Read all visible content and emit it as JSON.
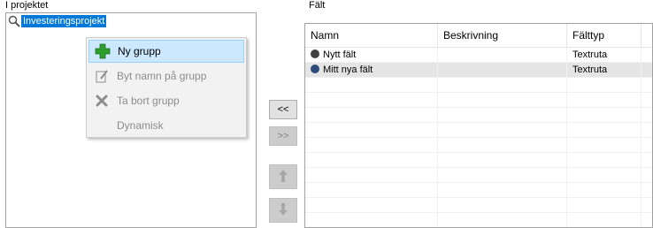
{
  "left_panel": {
    "title": "I projektet",
    "tree_root_label": "Investeringsprojekt"
  },
  "context_menu": {
    "items": [
      {
        "label": "Ny grupp",
        "icon": "plus-icon",
        "enabled": true,
        "highlighted": true
      },
      {
        "label": "Byt namn på grupp",
        "icon": "rename-icon",
        "enabled": false
      },
      {
        "label": "Ta bort grupp",
        "icon": "delete-icon",
        "enabled": false
      },
      {
        "label": "Dynamisk",
        "icon": "",
        "enabled": false
      }
    ]
  },
  "middle_buttons": {
    "move_left": "<<",
    "move_right": ">>",
    "move_up_icon": "arrow-up-icon",
    "move_down_icon": "arrow-down-icon"
  },
  "right_panel": {
    "title": "Fält",
    "columns": [
      "Namn",
      "Beskrivning",
      "Fälttyp"
    ],
    "rows": [
      {
        "name": "Nytt fält",
        "description": "",
        "type": "Textruta",
        "dot_color": "#404040"
      },
      {
        "name": "Mitt nya fält",
        "description": "",
        "type": "Textruta",
        "dot_color": "#2f4b7c"
      }
    ]
  },
  "colors": {
    "selection": "#0078d7",
    "menu_highlight": "#cce8ff",
    "plus_green": "#2e9e2e"
  }
}
